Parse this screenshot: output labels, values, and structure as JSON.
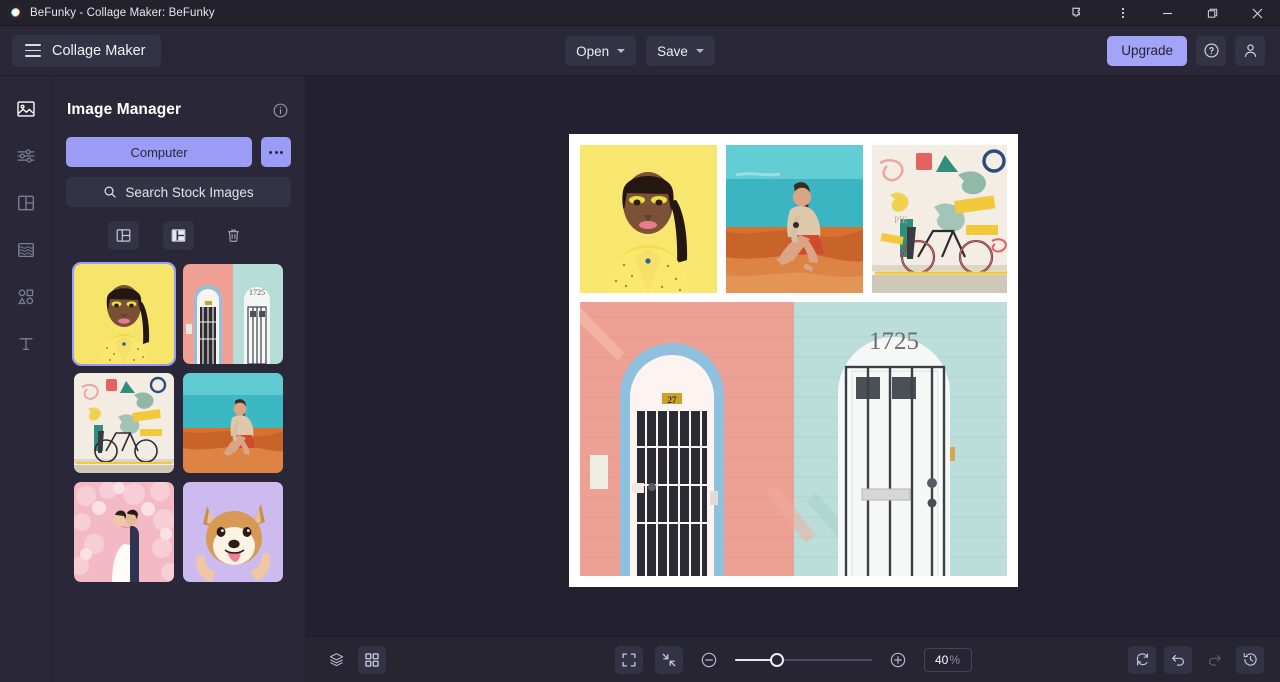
{
  "window": {
    "title": "BeFunky - Collage Maker: BeFunky",
    "favicon_name": "befunky-logo-icon",
    "controls": {
      "extensions": "extensions-icon",
      "menu": "browser-menu-icon",
      "minimize": "minimize-icon",
      "maximize": "maximize-icon",
      "close": "close-icon"
    }
  },
  "header": {
    "menu_label": "Collage Maker",
    "open_label": "Open",
    "save_label": "Save",
    "upgrade_label": "Upgrade",
    "help_icon": "help-circle-icon",
    "account_icon": "user-account-icon",
    "accent_color": "#a3a4f7"
  },
  "rail": {
    "items": [
      {
        "name": "image-manager",
        "icon": "image-icon",
        "active": true
      },
      {
        "name": "customize",
        "icon": "sliders-icon",
        "active": false
      },
      {
        "name": "layouts",
        "icon": "layout-grid-icon",
        "active": false
      },
      {
        "name": "textures",
        "icon": "texture-waves-icon",
        "active": false
      },
      {
        "name": "graphics",
        "icon": "shapes-icon",
        "active": false
      },
      {
        "name": "text",
        "icon": "text-t-icon",
        "active": false
      }
    ]
  },
  "panel": {
    "title": "Image Manager",
    "info_icon": "info-circle-icon",
    "computer_label": "Computer",
    "more_label": "more-options-icon",
    "search_label": "Search Stock Images",
    "search_icon": "search-icon",
    "tools": [
      {
        "name": "fill-layout-button",
        "icon": "layout-left-panel-icon",
        "active": false
      },
      {
        "name": "replace-layout-button",
        "icon": "layout-filled-panel-icon",
        "active": true
      },
      {
        "name": "delete-button",
        "icon": "trash-icon",
        "active": false
      }
    ],
    "thumbnails": [
      {
        "name": "thumbnail-portrait-yellow",
        "alt": "Woman in yellow shirt on yellow background",
        "selected": true
      },
      {
        "name": "thumbnail-two-doors",
        "alt": "Pink and mint colored doors",
        "selected": false
      },
      {
        "name": "thumbnail-bicycle-mural",
        "alt": "Bicycle against painted mural wall",
        "selected": false
      },
      {
        "name": "thumbnail-man-desert",
        "alt": "Man sitting on desert sand dune",
        "selected": false
      },
      {
        "name": "thumbnail-wedding-blossom",
        "alt": "Wedding couple among pink blossoms",
        "selected": false
      },
      {
        "name": "thumbnail-shiba-dog",
        "alt": "Shiba Inu dog on purple background",
        "selected": false
      }
    ]
  },
  "canvas": {
    "cells": [
      {
        "name": "collage-cell-portrait",
        "alt": "Woman in yellow shirt on yellow background"
      },
      {
        "name": "collage-cell-man-desert",
        "alt": "Man sitting on desert sand dune"
      },
      {
        "name": "collage-cell-bicycle-mural",
        "alt": "Bicycle against painted mural wall"
      },
      {
        "name": "collage-cell-two-doors",
        "alt": "Pink and mint doors numbered 27 and 1725"
      }
    ],
    "door_numbers": {
      "left": "27",
      "right": "1725"
    }
  },
  "bottombar": {
    "layers_icon": "layers-icon",
    "grid_icon": "grid-view-icon",
    "fit_icon": "fit-to-screen-icon",
    "shrink_icon": "shrink-to-fit-icon",
    "zoom_out_icon": "zoom-out-icon",
    "zoom_in_icon": "zoom-in-icon",
    "zoom_value": "40",
    "zoom_unit": "%",
    "reset_icon": "reset-rotate-icon",
    "undo_icon": "undo-icon",
    "redo_icon": "redo-icon",
    "history_icon": "history-clock-icon"
  }
}
